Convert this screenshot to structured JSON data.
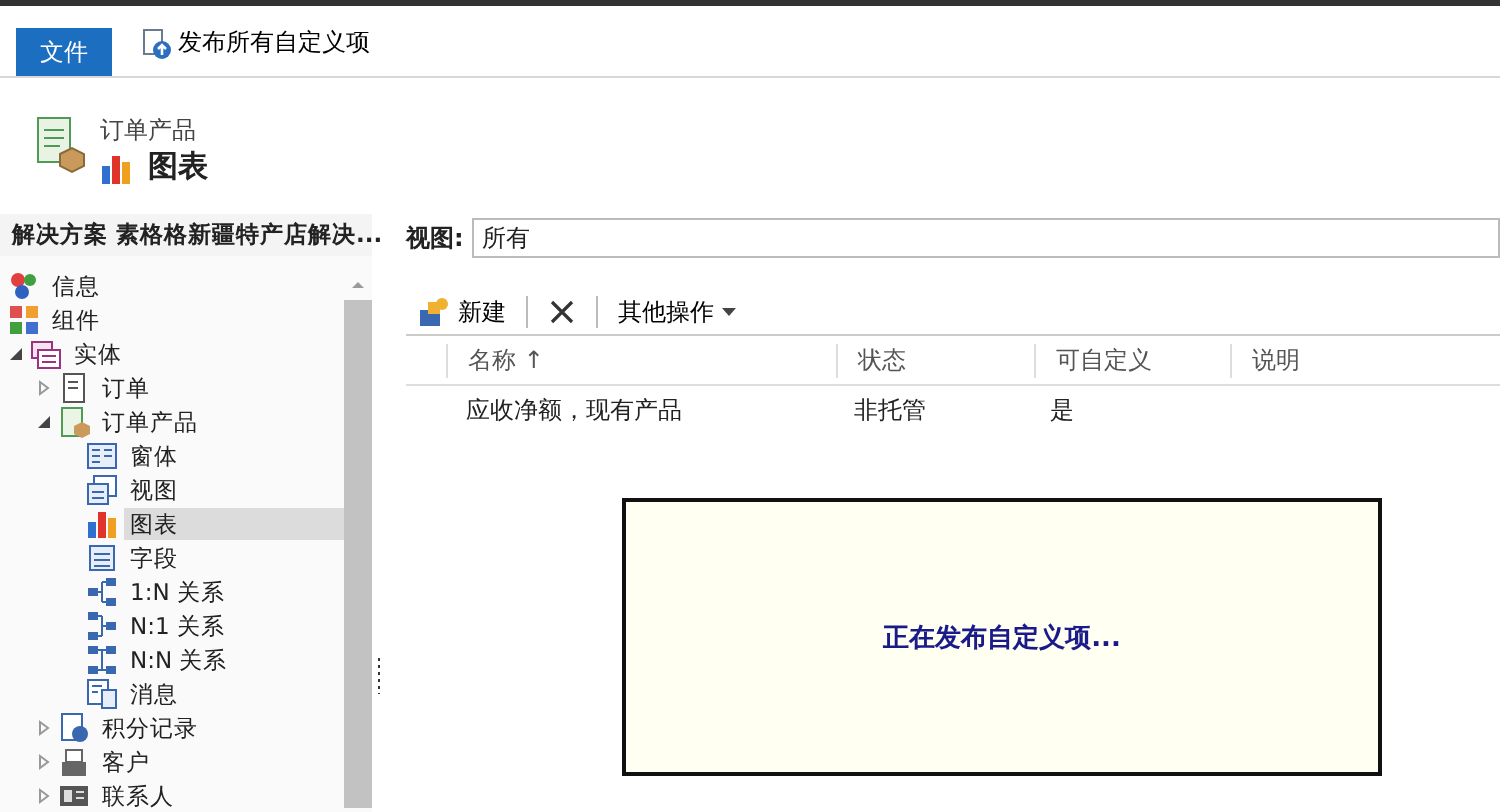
{
  "ribbon": {
    "file_tab": "文件",
    "publish_button": "发布所有自定义项"
  },
  "header": {
    "entity": "订单产品",
    "title": "图表"
  },
  "solution": {
    "title": "解决方案 素格格新疆特产店解决..."
  },
  "tree": [
    {
      "label": "信息",
      "kind": "info",
      "selected": false
    },
    {
      "label": "组件",
      "kind": "components",
      "selected": false
    },
    {
      "label": "实体",
      "kind": "entities",
      "selected": false,
      "expanded": true,
      "children": [
        {
          "label": "订单",
          "kind": "entity",
          "selected": false,
          "expanded": false
        },
        {
          "label": "订单产品",
          "kind": "entity-open",
          "selected": false,
          "expanded": true,
          "children": [
            {
              "label": "窗体",
              "kind": "form",
              "selected": false
            },
            {
              "label": "视图",
              "kind": "view",
              "selected": false
            },
            {
              "label": "图表",
              "kind": "chart",
              "selected": true
            },
            {
              "label": "字段",
              "kind": "field",
              "selected": false
            },
            {
              "label": "1:N 关系",
              "kind": "rel-1n",
              "selected": false
            },
            {
              "label": "N:1 关系",
              "kind": "rel-n1",
              "selected": false
            },
            {
              "label": "N:N 关系",
              "kind": "rel-nn",
              "selected": false
            },
            {
              "label": "消息",
              "kind": "message",
              "selected": false
            }
          ]
        },
        {
          "label": "积分记录",
          "kind": "record",
          "selected": false,
          "expanded": false
        },
        {
          "label": "客户",
          "kind": "account",
          "selected": false,
          "expanded": false
        },
        {
          "label": "联系人",
          "kind": "contact",
          "selected": false,
          "expanded": false
        }
      ]
    }
  ],
  "view": {
    "label": "视图:",
    "value": "所有"
  },
  "toolbar": {
    "new": "新建",
    "more": "其他操作"
  },
  "table": {
    "columns": [
      "名称 ↑",
      "状态",
      "可自定义",
      "说明"
    ],
    "rows": [
      [
        "应收净额，现有产品",
        "非托管",
        "是",
        ""
      ]
    ]
  },
  "dialog": {
    "message": "正在发布自定义项..."
  }
}
